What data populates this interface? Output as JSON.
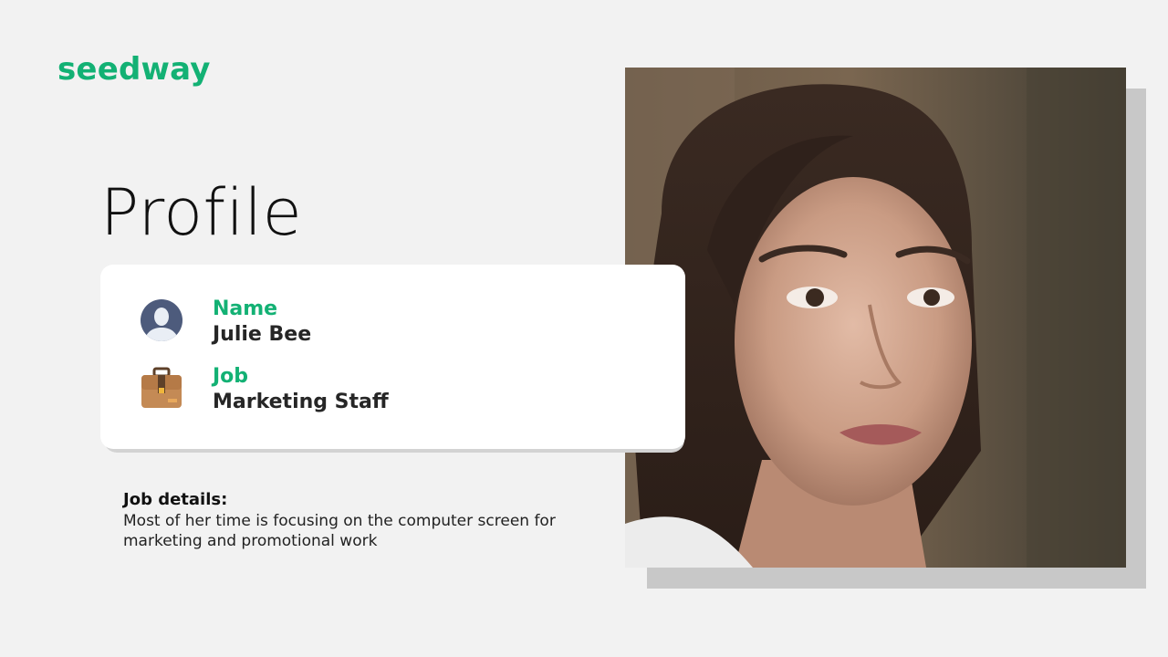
{
  "brand": {
    "logo_text": "seedway",
    "color": "#13b174"
  },
  "page": {
    "title": "Profile"
  },
  "profile_card": {
    "name": {
      "label": "Name",
      "value": "Julie Bee",
      "icon": "user-avatar-icon"
    },
    "job": {
      "label": "Job",
      "value": "Marketing Staff",
      "icon": "briefcase-icon"
    }
  },
  "details": {
    "heading": "Job details:",
    "body": "Most of her time is focusing on the computer screen for marketing and promotional work"
  },
  "photo": {
    "description_icon": "portrait-photo"
  }
}
